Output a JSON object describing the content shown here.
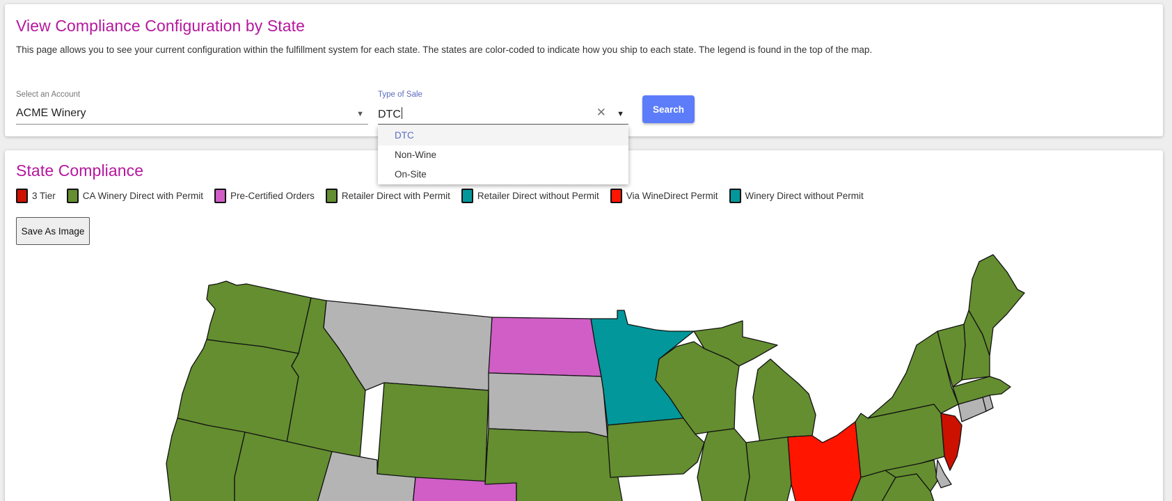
{
  "config": {
    "title": "View Compliance Configuration by State",
    "description": "This page allows you to see your current configuration within the fulfillment system for each state. The states are color-coded to indicate how you ship to each state. The legend is found in the top of the map.",
    "account": {
      "label": "Select an Account",
      "value": "ACME Winery"
    },
    "sale_type": {
      "label": "Type of Sale",
      "value": "DTC",
      "options": [
        "DTC",
        "Non-Wine",
        "On-Site"
      ],
      "selected_option": "DTC"
    },
    "search_label": "Search"
  },
  "compliance": {
    "title": "State Compliance",
    "legend": [
      {
        "label": "3 Tier",
        "color": "#cc1100"
      },
      {
        "label": "CA Winery Direct with Permit",
        "color": "#648e30"
      },
      {
        "label": "Pre-Certified Orders",
        "color": "#d05ec6"
      },
      {
        "label": "Retailer Direct with Permit",
        "color": "#648e30"
      },
      {
        "label": "Retailer Direct without Permit",
        "color": "#02979a"
      },
      {
        "label": "Via WineDirect Permit",
        "color": "#ff1500"
      },
      {
        "label": "Winery Direct without Permit",
        "color": "#02979a"
      }
    ],
    "save_label": "Save As Image",
    "colors": {
      "green": "#648e30",
      "gray": "#b4b4b4",
      "pink": "#d05ec6",
      "teal": "#02979a",
      "red": "#ff1500",
      "dark_red": "#cc1100"
    }
  }
}
